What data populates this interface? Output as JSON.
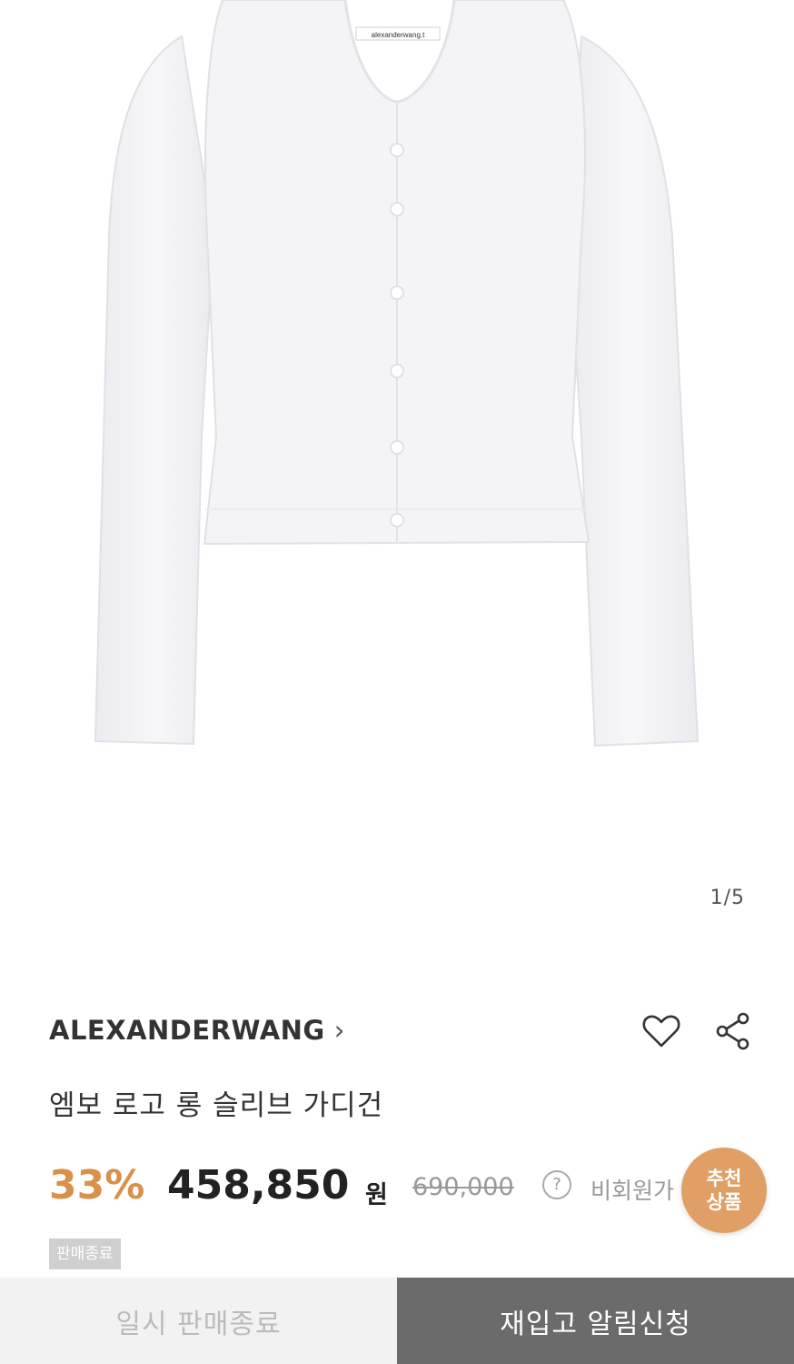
{
  "gallery": {
    "image_label": "alexanderwang.t",
    "counter": "1/5"
  },
  "product": {
    "brand": "ALEXANDERWANG",
    "brand_chevron": "›",
    "title": "엠보 로고 롱 슬리브 가디건",
    "discount": "33%",
    "price": "458,850",
    "currency": "원",
    "original_price": "690,000",
    "help_symbol": "?",
    "member_price_label": "비회원가",
    "status_badge": "판매종료"
  },
  "actions": {
    "wishlist_icon": "heart-icon",
    "share_icon": "share-icon"
  },
  "recommend": {
    "line1": "추천",
    "line2": "상품"
  },
  "bottom_bar": {
    "left_label": "일시 판매종료",
    "right_label": "재입고 알림신청"
  },
  "colors": {
    "discount": "#d9904a",
    "recommend_bg": "#e0a065",
    "right_button_bg": "#6b6b6b",
    "left_button_bg": "#f2f2f2"
  }
}
